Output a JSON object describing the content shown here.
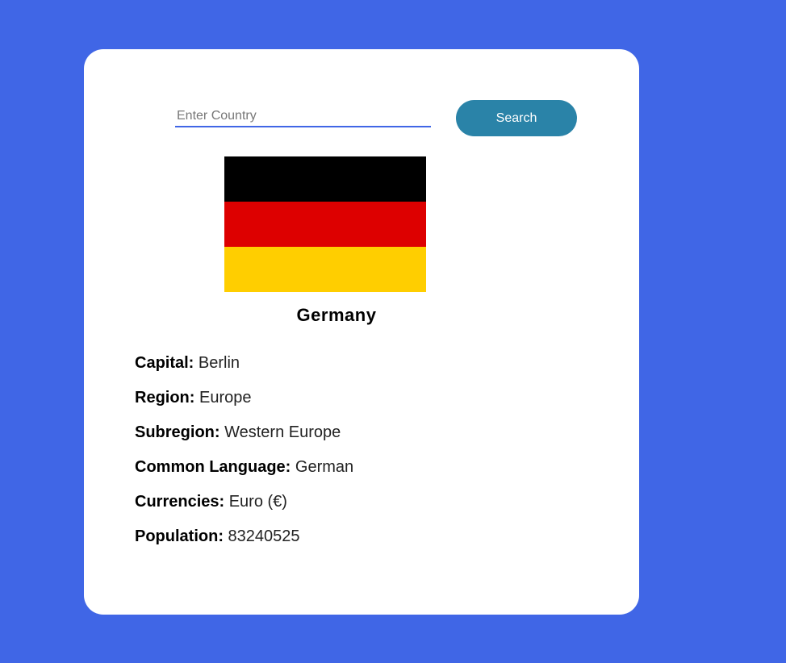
{
  "search": {
    "placeholder": "Enter Country",
    "value": "",
    "button_label": "Search"
  },
  "flag": {
    "colors": [
      "#000000",
      "#dd0000",
      "#ffce00"
    ]
  },
  "country": {
    "name": "Germany"
  },
  "details": [
    {
      "label": "Capital:",
      "value": "Berlin"
    },
    {
      "label": "Region:",
      "value": "Europe"
    },
    {
      "label": "Subregion:",
      "value": "Western Europe"
    },
    {
      "label": "Common Language:",
      "value": "German"
    },
    {
      "label": "Currencies:",
      "value": "Euro (€)"
    },
    {
      "label": "Population:",
      "value": "83240525"
    }
  ],
  "theme": {
    "background": "#4066e6",
    "card": "#ffffff",
    "button": "#2a83a8"
  }
}
